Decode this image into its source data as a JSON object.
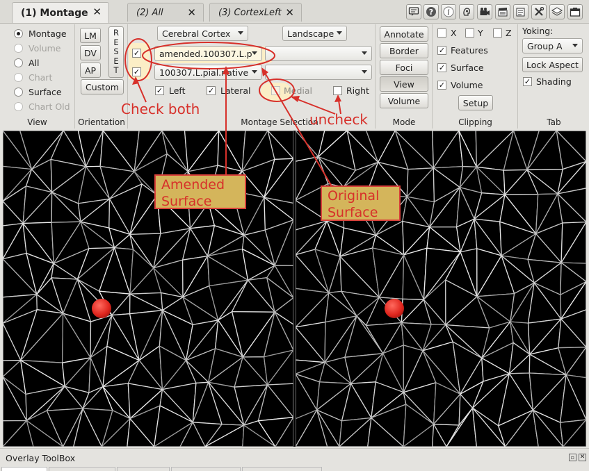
{
  "tabs": [
    {
      "label": "(1) Montage",
      "close": "✕"
    },
    {
      "label": "(2) All",
      "close": "✕"
    },
    {
      "label": "(3) CortexLeft",
      "close": "✕"
    }
  ],
  "toolbar_icons": [
    "info-panel-icon",
    "help-icon",
    "information-icon",
    "identify-icon",
    "movie-icon",
    "scene-icon",
    "tools-icon",
    "layers-icon",
    "window-icon"
  ],
  "view": {
    "section_label": "View",
    "options": [
      {
        "label": "Montage",
        "selected": true,
        "enabled": true
      },
      {
        "label": "Volume",
        "selected": false,
        "enabled": false
      },
      {
        "label": "All",
        "selected": false,
        "enabled": true
      },
      {
        "label": "Chart",
        "selected": false,
        "enabled": false
      },
      {
        "label": "Surface",
        "selected": false,
        "enabled": true
      },
      {
        "label": "Chart Old",
        "selected": false,
        "enabled": false
      }
    ]
  },
  "orientation": {
    "section_label": "Orientation",
    "buttons": [
      "LM",
      "DV",
      "AP"
    ],
    "custom": "Custom",
    "reset_letters": [
      "R",
      "E",
      "S",
      "E",
      "T"
    ]
  },
  "montage": {
    "section_label": "Montage Selection",
    "structure": "Cerebral Cortex",
    "layout": "Landscape",
    "surface_1": "amended.100307.L.p",
    "surface_2": "100307.L.pial.native",
    "surface_1_checked": true,
    "surface_2_checked": true,
    "left_label": "Left",
    "lateral_label": "Lateral",
    "medial_label": "Medial",
    "right_label": "Right",
    "left_checked": true,
    "lateral_checked": true,
    "medial_checked": false,
    "right_checked": true
  },
  "mode": {
    "section_label": "Mode",
    "buttons": [
      "Annotate",
      "Border",
      "Foci",
      "View",
      "Volume"
    ],
    "active": "View"
  },
  "clipping": {
    "section_label": "Clipping",
    "axes": [
      "X",
      "Y",
      "Z"
    ],
    "features": "Features",
    "surface": "Surface",
    "volume": "Volume",
    "setup": "Setup"
  },
  "tab_section": {
    "section_label": "Tab",
    "yoking_label": "Yoking:",
    "yoking_value": "Group A",
    "lock_aspect": "Lock Aspect",
    "shading": "Shading"
  },
  "annotations": {
    "check_both": "Check both",
    "uncheck": "uncheck",
    "amended_surface_line1": "Amended",
    "amended_surface_line2": "Surface",
    "original_surface_line1": "Original",
    "original_surface_line2": "Surface"
  },
  "overlay_toolbox": {
    "title": "Overlay ToolBox"
  },
  "colors": {
    "annotation_red": "#d7302a",
    "callout_fill": "#d4b55b",
    "highlight_fill": "#fbeec6",
    "marker_red": "#e0261e"
  }
}
